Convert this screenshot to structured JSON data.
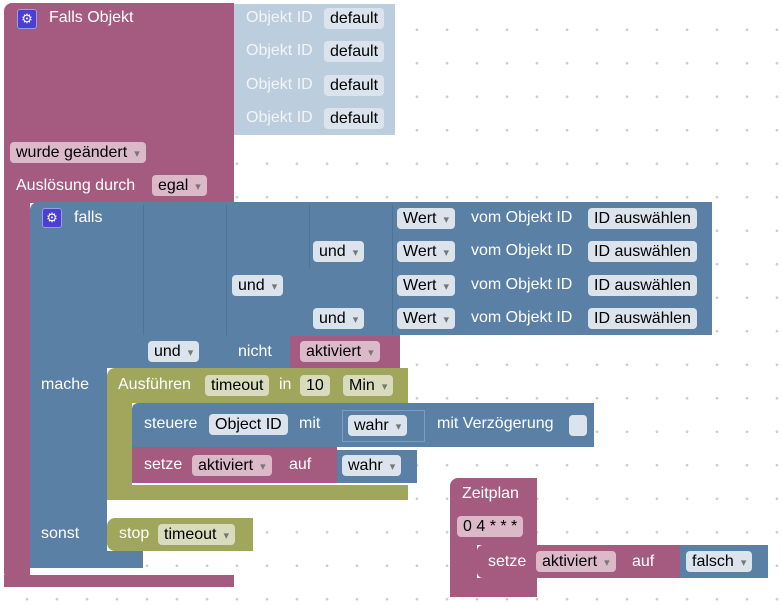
{
  "trigger": {
    "title": "Falls Objekt",
    "object_label": "Objekt ID",
    "object_ids": [
      "default",
      "default",
      "default",
      "default"
    ],
    "event": "wurde geändert",
    "trigger_by_label": "Auslösung durch",
    "trigger_by": "egal"
  },
  "if_block": {
    "falls": "falls",
    "mache": "mache",
    "sonst": "sonst",
    "conditions": [
      {
        "field": "Wert",
        "of": "vom Objekt ID",
        "id": "ID auswählen"
      },
      {
        "field": "Wert",
        "of": "vom Objekt ID",
        "id": "ID auswählen"
      },
      {
        "field": "Wert",
        "of": "vom Objekt ID",
        "id": "ID auswählen"
      },
      {
        "field": "Wert",
        "of": "vom Objekt ID",
        "id": "ID auswählen"
      }
    ],
    "and_ops": [
      "und",
      "und",
      "und",
      "und"
    ],
    "not_label": "nicht",
    "not_var": "aktiviert"
  },
  "timeout": {
    "label": "Ausführen",
    "name": "timeout",
    "in": "in",
    "value": "10",
    "unit": "Min"
  },
  "control": {
    "label": "steuere",
    "object": "Object ID",
    "with": "mit",
    "value": "wahr",
    "delay_label": "mit Verzögerung",
    "delay_checked": false
  },
  "set1": {
    "label": "setze",
    "var": "aktiviert",
    "to": "auf",
    "value": "wahr"
  },
  "stop": {
    "label": "stop",
    "name": "timeout"
  },
  "schedule": {
    "title": "Zeitplan",
    "cron": "0 4 * * *",
    "set_label": "setze",
    "var": "aktiviert",
    "to": "auf",
    "value": "falsch"
  },
  "colors": {
    "logic_purple": "#a55b80",
    "logic_blue": "#5b80a5",
    "timer_olive": "#a0a65c",
    "object_light": "#bccddd"
  }
}
